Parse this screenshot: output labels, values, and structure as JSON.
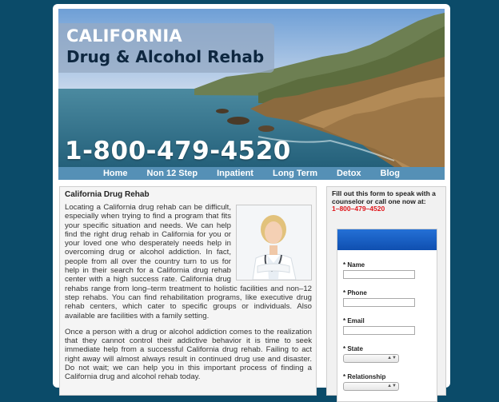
{
  "header": {
    "title_line1": "CALIFORNIA",
    "title_line2": "Drug & Alcohol Rehab",
    "phone": "1-800-479-4520"
  },
  "nav": {
    "items": [
      "Home",
      "Non 12 Step",
      "Inpatient",
      "Long Term",
      "Detox",
      "Blog"
    ]
  },
  "main": {
    "heading": "California Drug Rehab",
    "paragraph1": "Locating a California drug rehab can be difficult, especially when trying to find a program that fits your specific situation and needs. We can help find the right drug rehab in California for you or your loved one who desperately needs help in overcoming drug or alcohol addiction. In fact, people from all over the country turn to us for help in their search for a California drug rehab center with a high success rate. California drug rehabs range from long–term treatment to holistic facilities and non–12 step rehabs. You can find rehabilitation programs, like executive drug rehab centers, which cater to specific groups or individuals. Also available are facilities with a family setting.",
    "paragraph2": "Once a person with a drug or alcohol addiction comes to the realization that they cannot control their addictive behavior it is time to seek immediate help from a successful California drug rehab. Failing to act right away will almost always result in continued drug use and disaster. Do not wait; we can help you in this important process of finding a California drug and alcohol rehab today.",
    "photo_icon": "doctor-photo"
  },
  "sidebar": {
    "intro": "Fill out this form to speak with a counselor or call one now at:",
    "phone": "1–800–479–4520",
    "fields": [
      {
        "label": "* Name",
        "type": "text"
      },
      {
        "label": "* Phone",
        "type": "text"
      },
      {
        "label": "* Email",
        "type": "text"
      },
      {
        "label": "* State",
        "type": "select"
      },
      {
        "label": "* Relationship",
        "type": "select"
      }
    ]
  },
  "colors": {
    "page_bg": "#0b4b69",
    "nav_bg": "#5590b6",
    "form_header": "#1a5fc4",
    "phone_red": "#e0161b"
  }
}
